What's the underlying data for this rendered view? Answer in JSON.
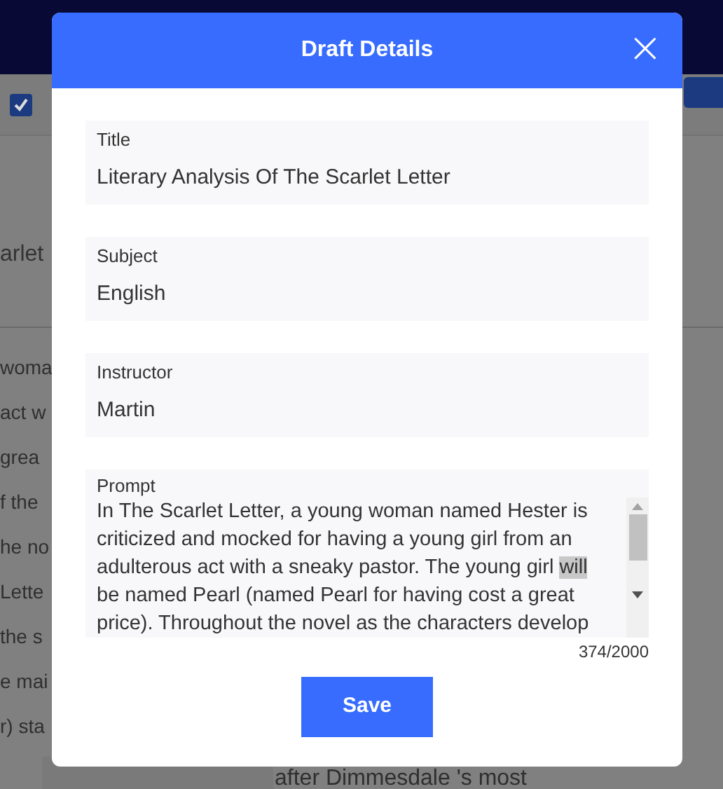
{
  "background": {
    "checkbox": {
      "checked": true
    },
    "heading_fragment": "arlet",
    "line_fragments": [
      "woma",
      "act w",
      "grea",
      "f the",
      "he no",
      "Lette",
      "the s",
      "e mai",
      "r) sta"
    ],
    "bottom_fragment": "after Dimmesdale 's most"
  },
  "dialog": {
    "title": "Draft Details",
    "close": "×",
    "fields": [
      {
        "label": "Title",
        "value": "Literary Analysis Of The Scarlet Letter"
      },
      {
        "label": "Subject",
        "value": "English"
      },
      {
        "label": "Instructor",
        "value": "Martin"
      }
    ],
    "prompt": {
      "label": "Prompt",
      "text_before": "In The Scarlet Letter, a young woman named Hester is criticized and mocked for having a young girl from an adulterous act with a sneaky pastor. The young girl ",
      "highlighted": "will",
      "text_after": " be named Pearl (named Pearl for having cost a great price). Throughout the novel as the characters develop",
      "counter": "374/2000"
    },
    "save": "Save"
  }
}
